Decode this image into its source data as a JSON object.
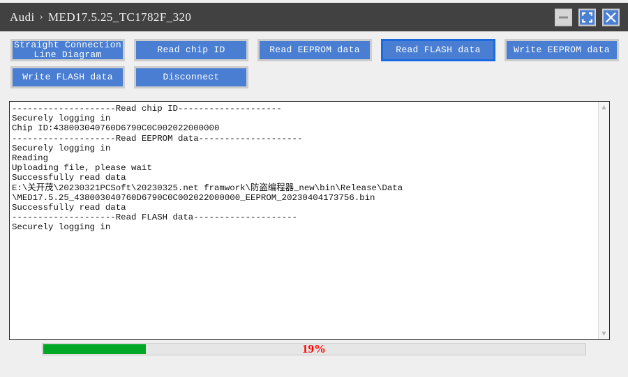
{
  "window": {
    "breadcrumb": {
      "root": "Audi",
      "separator": "›",
      "current": "MED17.5.25_TC1782F_320"
    },
    "controls": {
      "minimize_label": "minimize-icon",
      "maximize_label": "maximize-icon",
      "close_label": "close-icon"
    }
  },
  "toolbar": {
    "row1": [
      {
        "label": "Straight Connection\nLine Diagram",
        "focused": false
      },
      {
        "label": "Read chip ID",
        "focused": false
      },
      {
        "label": "Read EEPROM data",
        "focused": false
      },
      {
        "label": "Read FLASH data",
        "focused": true
      },
      {
        "label": "Write EEPROM data",
        "focused": false
      }
    ],
    "row2": [
      {
        "label": "Write FLASH data",
        "focused": false
      },
      {
        "label": "Disconnect",
        "focused": false
      }
    ]
  },
  "log": {
    "text": "--------------------Read chip ID--------------------\nSecurely logging in\nChip ID:438003040760D6790C0C002022000000\n--------------------Read EEPROM data--------------------\nSecurely logging in\nReading\nUploading file, please wait\nSuccessfully read data\nE:\\关开茂\\20230321PCSoft\\20230325.net framwork\\防盗编程器_new\\bin\\Release\\Data\n\\MED17.5.25_438003040760D6790C0C002022000000_EEPROM_20230404173756.bin\nSuccessfully read data\n--------------------Read FLASH data--------------------\nSecurely logging in",
    "scrollbar": {
      "up_arrow": "▲",
      "down_arrow": "▼"
    }
  },
  "progress": {
    "percent": 19,
    "label": "19%",
    "fill_color": "#00a826",
    "text_color": "#ff0000"
  },
  "colors": {
    "titlebar": "#414141",
    "button_blue": "#4a7ed2",
    "focus_border": "#1a6ae0",
    "page_background": "#efefef"
  }
}
